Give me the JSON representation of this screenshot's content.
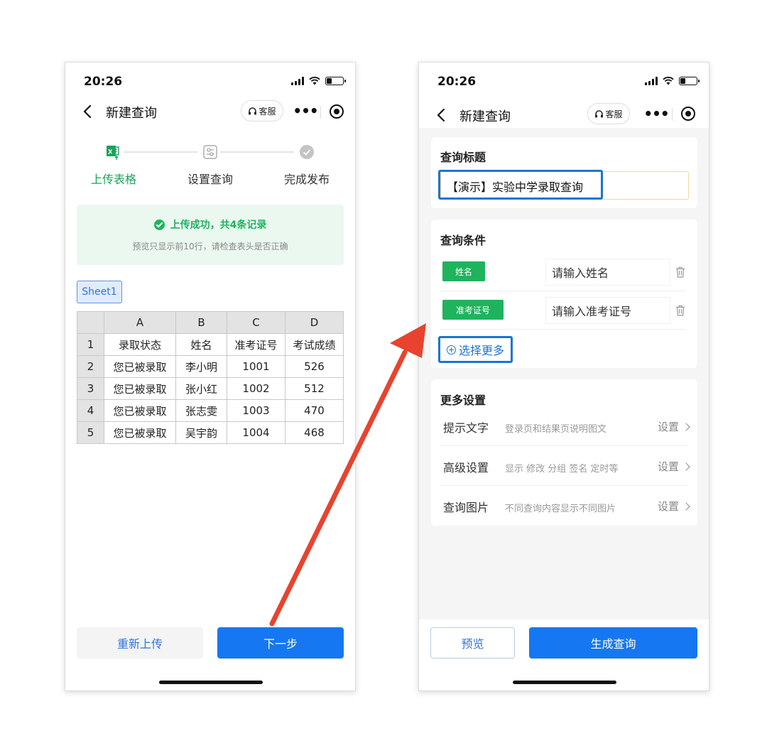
{
  "left": {
    "status": {
      "time": "20:26"
    },
    "nav": {
      "title": "新建查询",
      "kefu": "客服"
    },
    "steps": [
      {
        "label": "上传表格"
      },
      {
        "label": "设置查询"
      },
      {
        "label": "完成发布"
      }
    ],
    "upload": {
      "title": "上传成功，共4条记录",
      "subtitle": "预览只显示前10行，请检查表头是否正确"
    },
    "sheet_tab": "Sheet1",
    "table": {
      "columns": [
        "A",
        "B",
        "C",
        "D"
      ],
      "rows": [
        {
          "n": "1",
          "cells": [
            "录取状态",
            "姓名",
            "准考证号",
            "考试成绩"
          ]
        },
        {
          "n": "2",
          "cells": [
            "您已被录取",
            "李小明",
            "1001",
            "526"
          ]
        },
        {
          "n": "3",
          "cells": [
            "您已被录取",
            "张小红",
            "1002",
            "512"
          ]
        },
        {
          "n": "4",
          "cells": [
            "您已被录取",
            "张志雯",
            "1003",
            "470"
          ]
        },
        {
          "n": "5",
          "cells": [
            "您已被录取",
            "吴宇韵",
            "1004",
            "468"
          ]
        }
      ]
    },
    "buttons": {
      "reupload": "重新上传",
      "next": "下一步"
    }
  },
  "right": {
    "status": {
      "time": "20:26"
    },
    "nav": {
      "title": "新建查询",
      "kefu": "客服"
    },
    "title_section": {
      "heading": "查询标题",
      "value": "【演示】实验中学录取查询"
    },
    "conditions": {
      "heading": "查询条件",
      "items": [
        {
          "tag": "姓名",
          "placeholder": "请输入姓名"
        },
        {
          "tag": "准考证号",
          "placeholder": "请输入准考证号"
        }
      ],
      "more_label": "选择更多"
    },
    "settings": {
      "heading": "更多设置",
      "items": [
        {
          "label": "提示文字",
          "desc": "登录页和结果页说明图文",
          "action": "设置"
        },
        {
          "label": "高级设置",
          "desc": "显示 修改 分组 签名 定时等",
          "action": "设置"
        },
        {
          "label": "查询图片",
          "desc": "不同查询内容显示不同图片",
          "action": "设置"
        }
      ]
    },
    "buttons": {
      "preview": "预览",
      "generate": "生成查询"
    }
  },
  "colors": {
    "primary_blue": "#1677f2",
    "success_green": "#1fb35d",
    "step_active": "#1ba25a",
    "highlight_blue": "#1a74d4",
    "arrow_red": "#e8432e"
  }
}
